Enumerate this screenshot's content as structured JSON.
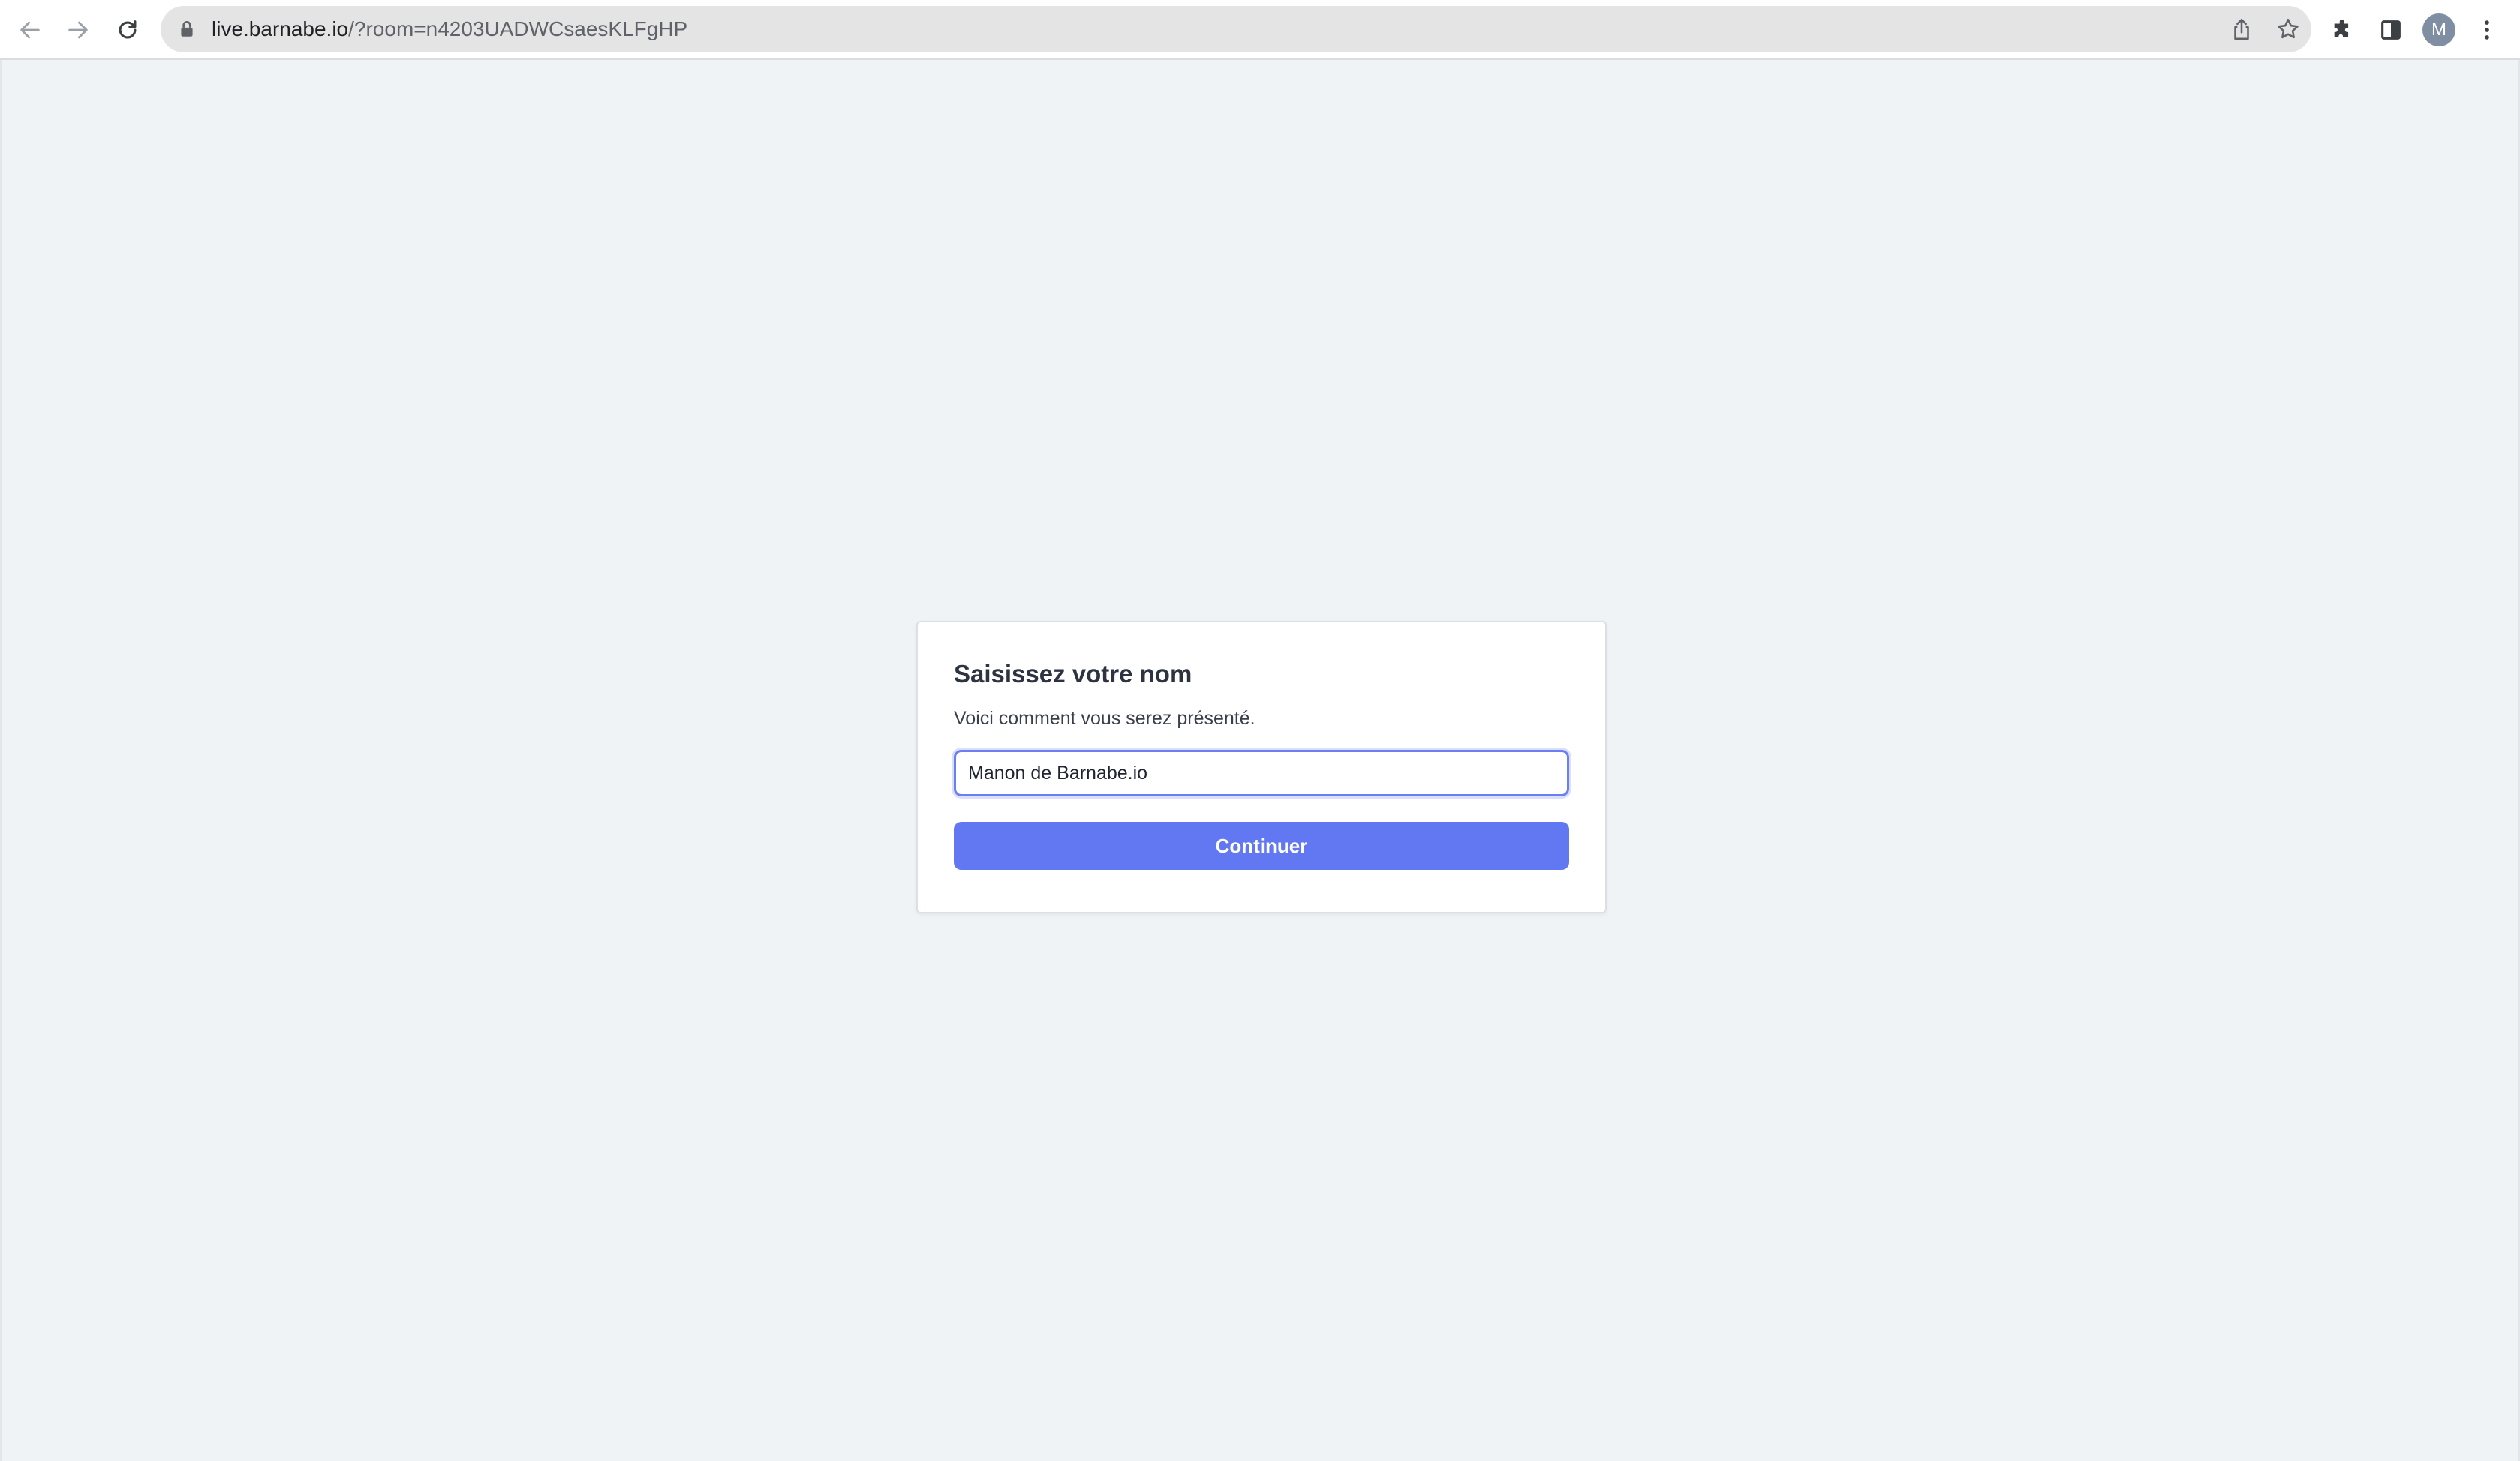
{
  "browser": {
    "url_host": "live.barnabe.io",
    "url_path": "/?room=n4203UADWCsaesKLFgHP",
    "profile_initial": "M",
    "icons": {
      "back": "arrow-left-icon",
      "forward": "arrow-right-icon",
      "reload": "reload-icon",
      "lock": "lock-icon",
      "share": "share-icon",
      "bookmark": "star-icon",
      "extensions": "puzzle-icon",
      "side_panel": "side-panel-icon",
      "menu": "kebab-menu-icon"
    }
  },
  "name_dialog": {
    "title": "Saisissez votre nom",
    "subtitle": "Voici comment vous serez présenté.",
    "name_value": "Manon de Barnabe.io",
    "continue_label": "Continuer"
  },
  "colors": {
    "accent": "#6278f2",
    "focus_ring": "#6b7ff3",
    "page_background": "#f0f3f6"
  }
}
